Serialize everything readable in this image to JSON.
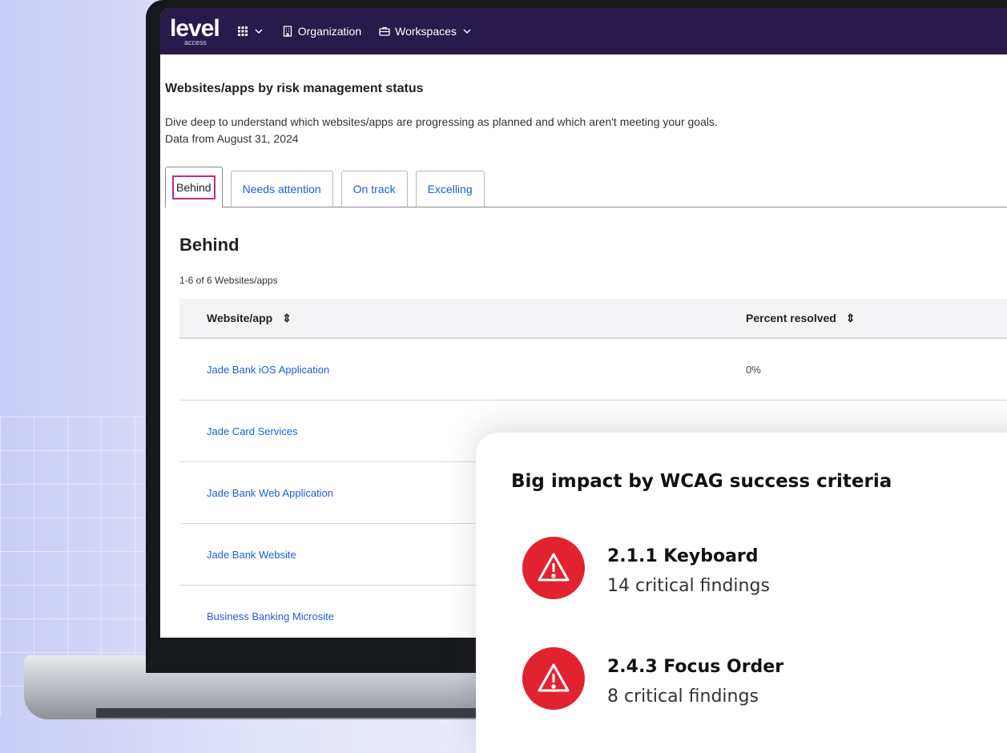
{
  "topbar": {
    "logo": "level",
    "logo_sub": "access",
    "apps_menu": "",
    "organization": "Organization",
    "workspaces": "Workspaces"
  },
  "main": {
    "section_title": "Websites/apps by risk management status",
    "description": "Dive deep to understand which websites/apps are progressing as planned and which aren't meeting your goals.",
    "data_date": "Data from August 31, 2024",
    "tabs": [
      {
        "label": "Behind",
        "active": true
      },
      {
        "label": "Needs attention",
        "active": false
      },
      {
        "label": "On track",
        "active": false
      },
      {
        "label": "Excelling",
        "active": false
      }
    ],
    "heading": "Behind",
    "count": "1-6 of 6 Websites/apps",
    "table": {
      "columns": [
        "Website/app",
        "Percent resolved"
      ],
      "rows": [
        {
          "name": "Jade Bank iOS Application",
          "percent": "0%"
        },
        {
          "name": "Jade Card Services",
          "percent": ""
        },
        {
          "name": "Jade Bank Web Application",
          "percent": ""
        },
        {
          "name": "Jade Bank Website",
          "percent": ""
        },
        {
          "name": "Business Banking Microsite",
          "percent": ""
        }
      ]
    }
  },
  "card": {
    "title": "Big impact by WCAG success criteria",
    "items": [
      {
        "title": "2.1.1 Keyboard",
        "subtitle": "14 critical findings"
      },
      {
        "title": "2.4.3 Focus Order",
        "subtitle": "8 critical findings"
      }
    ]
  },
  "colors": {
    "topbar": "#281a4a",
    "link": "#1d5fd6",
    "alert": "#e0232e",
    "focus_ring": "#c02a8c"
  },
  "icons": [
    "grid-icon",
    "chevron-down-icon",
    "building-icon",
    "briefcase-icon",
    "sort-icon",
    "warning-icon"
  ]
}
